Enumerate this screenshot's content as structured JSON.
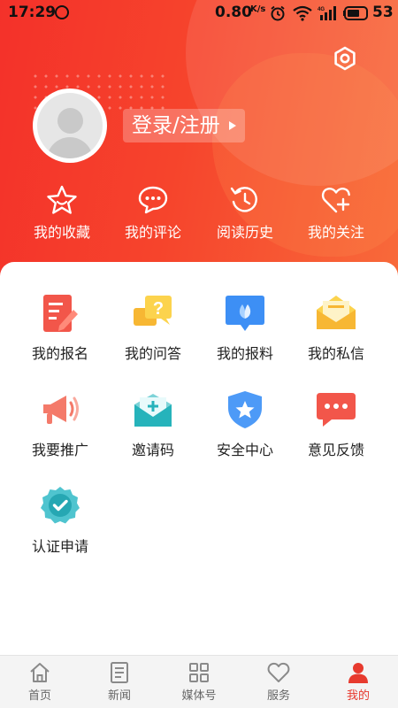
{
  "status_bar": {
    "time": "17:29",
    "net_speed": "0.80",
    "speed_unit": "K/s",
    "network": "4G",
    "battery": "53"
  },
  "profile": {
    "login_label": "登录/注册"
  },
  "quick_actions": [
    {
      "label": "我的收藏",
      "icon": "star-icon"
    },
    {
      "label": "我的评论",
      "icon": "comment-icon"
    },
    {
      "label": "阅读历史",
      "icon": "history-icon"
    },
    {
      "label": "我的关注",
      "icon": "heart-plus-icon"
    }
  ],
  "services": [
    {
      "label": "我的报名",
      "icon": "signup-icon"
    },
    {
      "label": "我的问答",
      "icon": "qa-icon"
    },
    {
      "label": "我的报料",
      "icon": "tipoff-icon"
    },
    {
      "label": "我的私信",
      "icon": "message-icon"
    },
    {
      "label": "我要推广",
      "icon": "megaphone-icon"
    },
    {
      "label": "邀请码",
      "icon": "invite-icon"
    },
    {
      "label": "安全中心",
      "icon": "shield-icon"
    },
    {
      "label": "意见反馈",
      "icon": "feedback-icon"
    },
    {
      "label": "认证申请",
      "icon": "certification-icon"
    }
  ],
  "tabs": [
    {
      "label": "首页",
      "icon": "home-icon"
    },
    {
      "label": "新闻",
      "icon": "news-icon"
    },
    {
      "label": "媒体号",
      "icon": "media-icon"
    },
    {
      "label": "服务",
      "icon": "service-icon"
    },
    {
      "label": "我的",
      "icon": "user-icon"
    }
  ],
  "colors": {
    "brand_red": "#f4312a",
    "tab_active": "#e73a2e"
  }
}
